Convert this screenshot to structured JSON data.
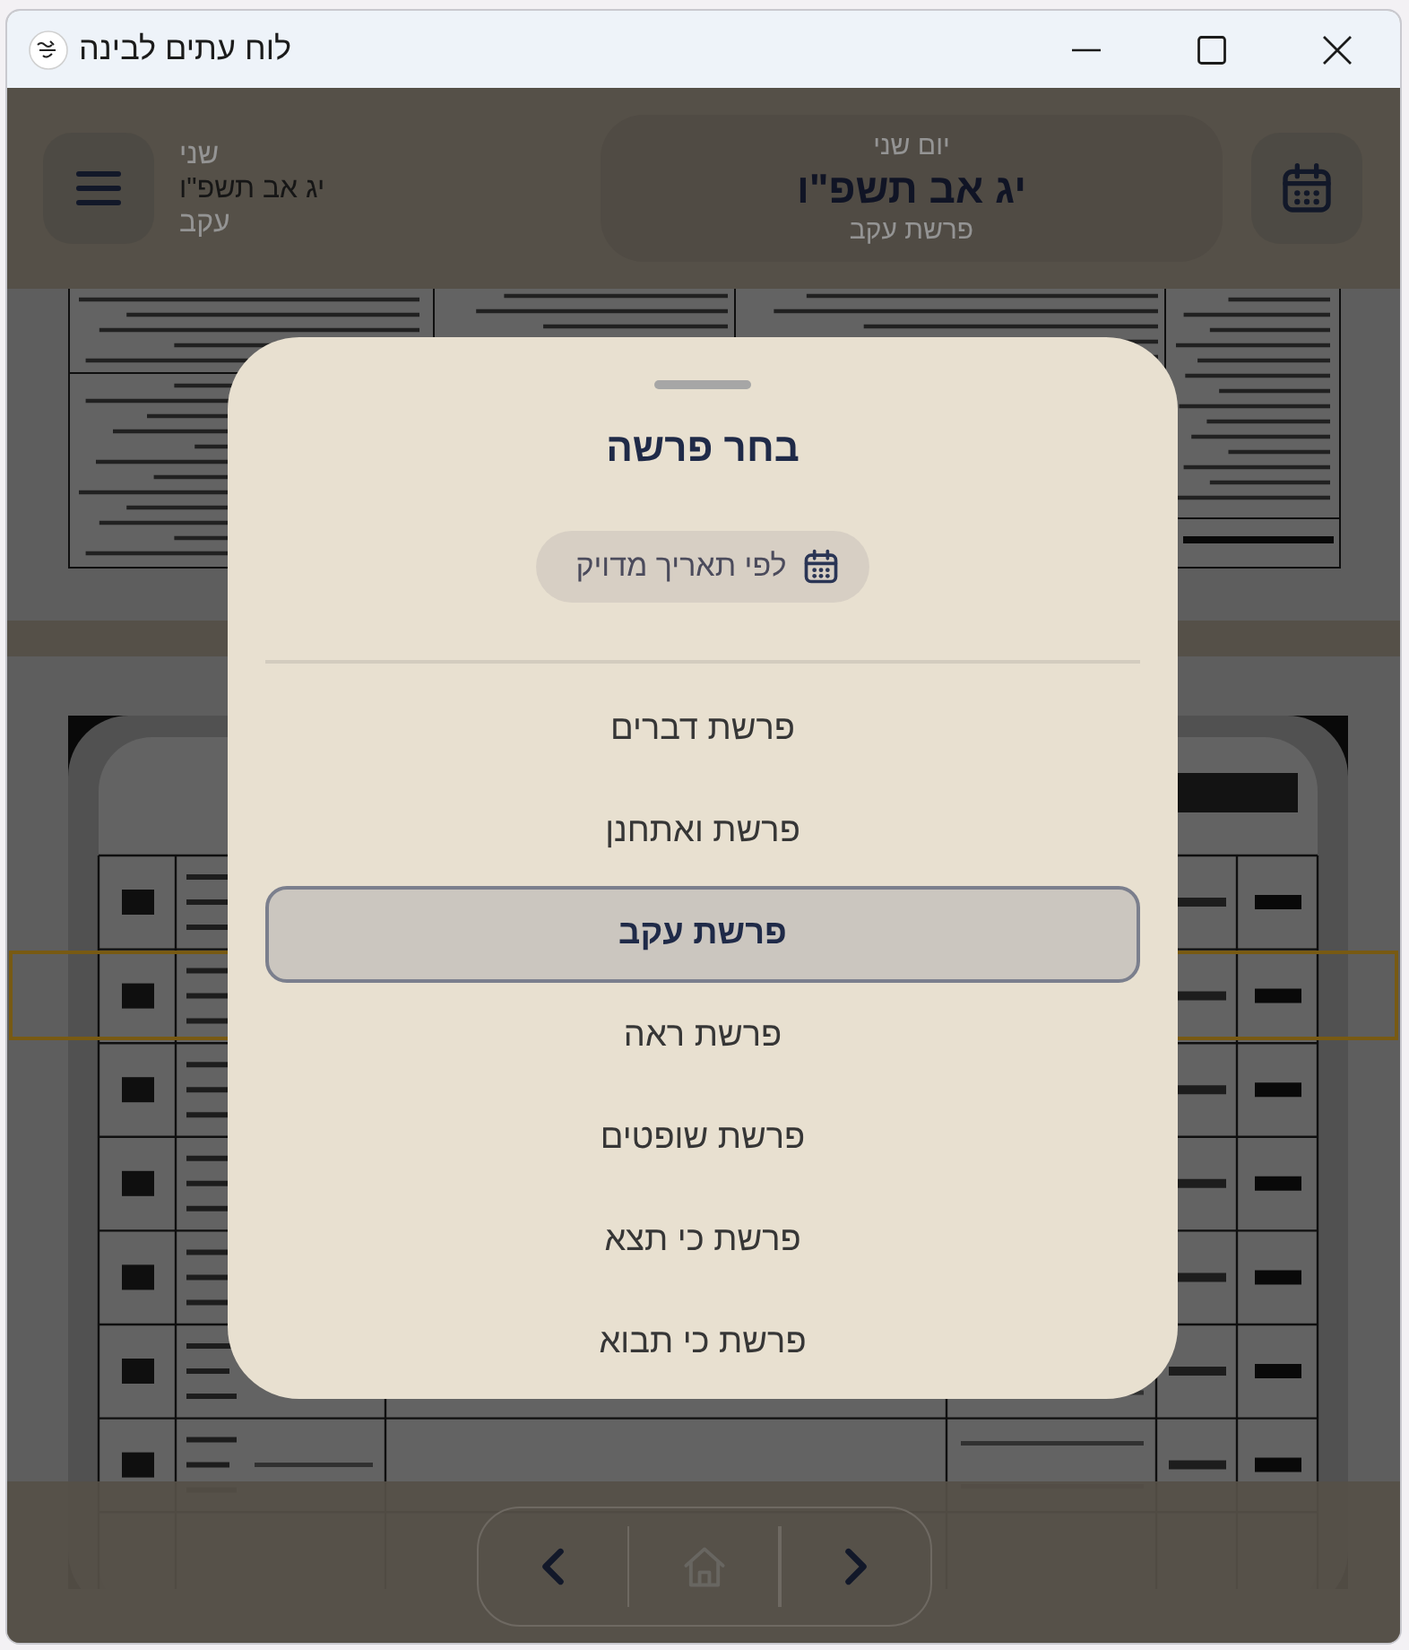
{
  "window": {
    "title": "לוח עתים לבינה"
  },
  "header": {
    "summary": {
      "day": "שני",
      "date": "יג אב תשפ\"ו",
      "parasha": "עקב"
    },
    "date_card": {
      "weekday": "יום שני",
      "date": "יג אב תשפ\"ו",
      "parasha": "פרשת עקב"
    }
  },
  "scans": [
    {
      "kind": "text_page",
      "current_day_marked": false
    },
    {
      "kind": "table_page",
      "current_day_marked": true
    }
  ],
  "parasha_picker": {
    "title": "בחר פרשה",
    "exact_date_button": "לפי תאריך מדויק",
    "options": [
      {
        "label": "פרשת דברים",
        "selected": false
      },
      {
        "label": "פרשת ואתחנן",
        "selected": false
      },
      {
        "label": "פרשת עקב",
        "selected": true
      },
      {
        "label": "פרשת ראה",
        "selected": false
      },
      {
        "label": "פרשת שופטים",
        "selected": false
      },
      {
        "label": "פרשת כי תצא",
        "selected": false
      },
      {
        "label": "פרשת כי תבוא",
        "selected": false
      }
    ]
  },
  "nav": [
    {
      "kind": "left_arrow",
      "disabled": false
    },
    {
      "kind": "home",
      "disabled": true
    },
    {
      "kind": "right_arrow",
      "disabled": false
    }
  ]
}
